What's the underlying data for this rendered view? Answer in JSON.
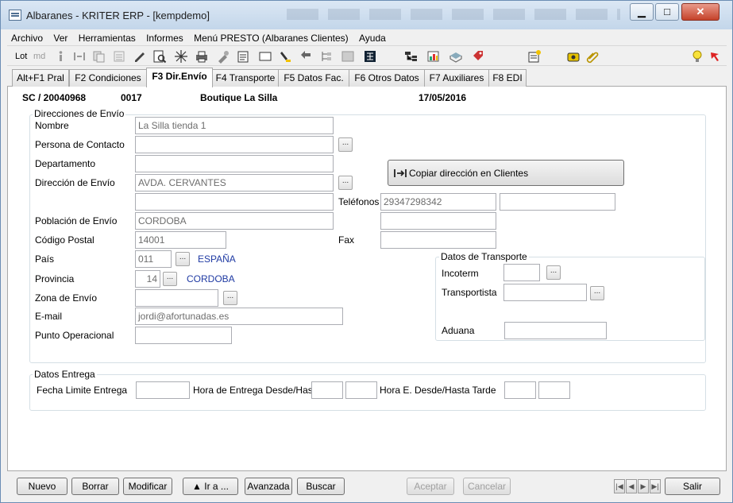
{
  "window": {
    "title": "Albaranes - KRITER ERP -  [kempdemo]"
  },
  "menu": [
    "Archivo",
    "Ver",
    "Herramientas",
    "Informes",
    "Menú PRESTO (Albaranes Clientes)",
    "Ayuda"
  ],
  "toolbar": {
    "lot_label": "Lot",
    "md_label": "md"
  },
  "tabs": [
    "Alt+F1 Pral",
    "F2 Condiciones",
    "F3 Dir.Envío",
    "F4 Transporte",
    "F5 Datos Fac.",
    "F6 Otros Datos",
    "F7 Auxiliares",
    "F8 EDI"
  ],
  "active_tab": "F3 Dir.Envío",
  "header": {
    "doc": "SC / 20040968",
    "code": "0017",
    "customer": "Boutique La Silla",
    "date": "17/05/2016"
  },
  "shipping": {
    "legend": "Direcciones de Envío",
    "labels": {
      "nombre": "Nombre",
      "contacto": "Persona de Contacto",
      "departamento": "Departamento",
      "direccion": "Dirección de Envío",
      "telefonos": "Teléfonos",
      "poblacion": "Población de Envío",
      "cp": "Código Postal",
      "fax": "Fax",
      "pais": "País",
      "provincia": "Provincia",
      "zona": "Zona de Envío",
      "email": "E-mail",
      "punto": "Punto Operacional"
    },
    "values": {
      "nombre": "La Silla tienda 1",
      "contacto": "",
      "departamento": "",
      "direccion": "AVDA. CERVANTES",
      "direccion2": "",
      "telefono1": "29347298342",
      "telefono2": "",
      "telefono3": "",
      "poblacion": "CORDOBA",
      "cp": "14001",
      "fax": "",
      "pais_code": "011",
      "pais_name": "ESPAÑA",
      "provincia_code": "14",
      "provincia_name": "CORDOBA",
      "zona": "",
      "email": "jordi@afortunadas.es",
      "punto": ""
    },
    "copy_button": "Copiar dirección en Clientes",
    "dots": "..."
  },
  "transport": {
    "legend": "Datos de Transporte",
    "labels": {
      "incoterm": "Incoterm",
      "transportista": "Transportista",
      "aduana": "Aduana"
    },
    "values": {
      "incoterm": "",
      "transportista": "",
      "aduana": ""
    }
  },
  "delivery": {
    "legend": "Datos Entrega",
    "labels": {
      "fecha": "Fecha Limite Entrega",
      "hora": "Hora de Entrega Desde/Hasta",
      "hora_tarde": "Hora E. Desde/Hasta Tarde"
    },
    "values": {
      "fecha": "",
      "hora_desde": "",
      "hora_hasta": "",
      "tarde_desde": "",
      "tarde_hasta": ""
    }
  },
  "buttons": {
    "nuevo": "Nuevo",
    "borrar": "Borrar",
    "modificar": "Modificar",
    "ira": "▲ Ir a ...",
    "avanzada": "Avanzada",
    "buscar": "Buscar",
    "aceptar": "Aceptar",
    "cancelar": "Cancelar",
    "salir": "Salir"
  },
  "colors": {
    "accent_blue": "#1f3aa3",
    "close_red": "#c5422a"
  }
}
